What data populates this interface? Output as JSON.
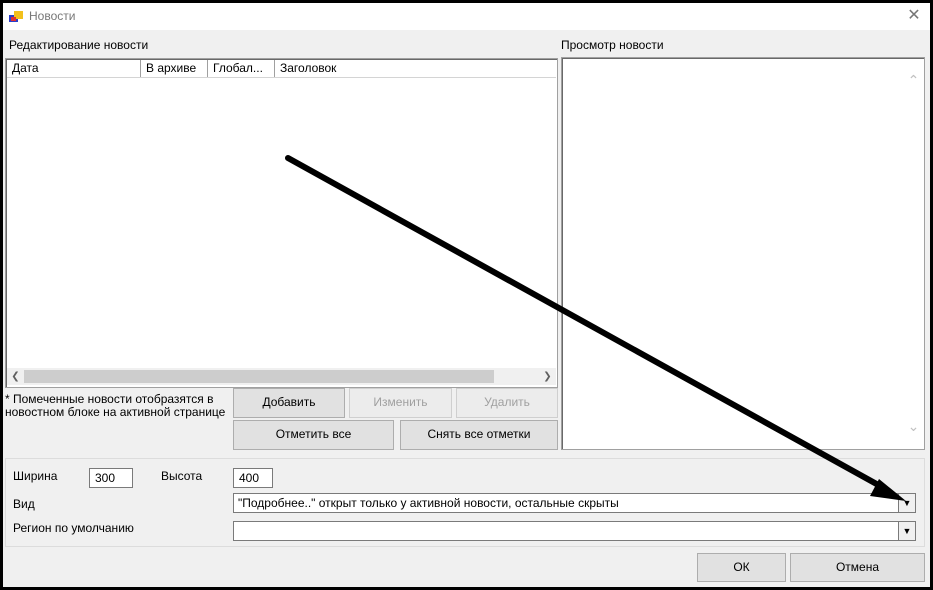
{
  "window": {
    "title": "Новости"
  },
  "editor": {
    "section_label": "Редактирование новости",
    "columns": [
      "Дата",
      "В архиве",
      "Глобал...",
      "Заголовок"
    ],
    "note": "* Помеченные новости отобразятся в новостном блоке на активной странице",
    "buttons": {
      "add": "Добавить",
      "edit": "Изменить",
      "delete": "Удалить",
      "check_all": "Отметить все",
      "uncheck_all": "Снять все отметки"
    }
  },
  "preview": {
    "section_label": "Просмотр новости"
  },
  "settings": {
    "width_label": "Ширина",
    "width_value": "300",
    "height_label": "Высота",
    "height_value": "400",
    "view_label": "Вид",
    "view_value": "\"Подробнее..\" открыт только у активной новости, остальные скрыты",
    "region_label": "Регион по умолчанию",
    "region_value": ""
  },
  "footer": {
    "ok": "ОК",
    "cancel": "Отмена"
  },
  "icons": {
    "app": "news-app-icon",
    "close": "close-icon",
    "scroll_left": "chevron-left-icon",
    "scroll_right": "chevron-right-icon",
    "scroll_up": "chevron-up-icon",
    "scroll_down": "chevron-down-icon",
    "dropdown": "dropdown-arrow-icon",
    "annotation": "annotation-arrow"
  }
}
